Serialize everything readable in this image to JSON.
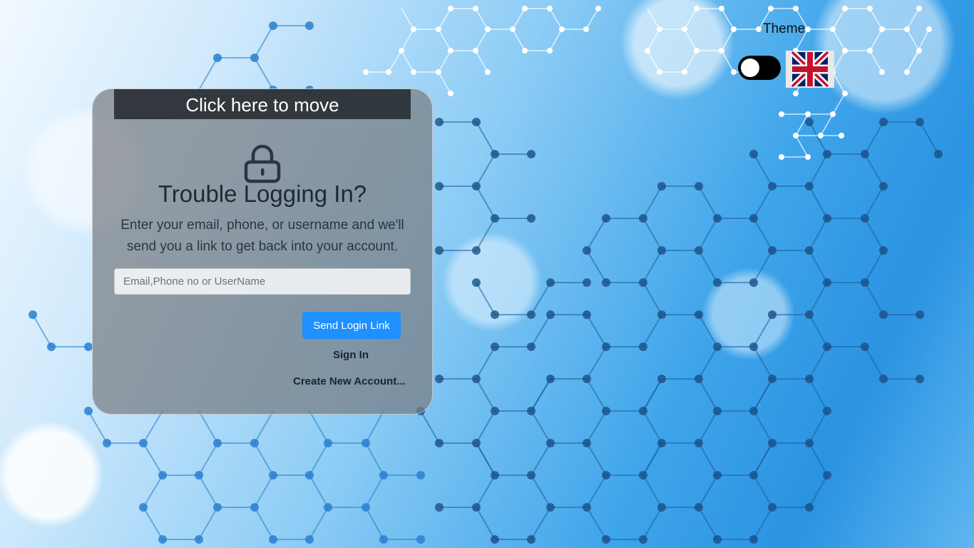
{
  "header": {
    "theme_label": "Theme",
    "theme_toggle_state": "off",
    "language_flag": "uk-flag-icon"
  },
  "card": {
    "move_handle_label": "Click here to move",
    "lock_icon": "lock-icon",
    "title": "Trouble Logging In?",
    "description": "Enter your email, phone, or username and we'll send you a link to get back into your account.",
    "email_input": {
      "placeholder": "Email,Phone no or UserName",
      "value": ""
    },
    "send_button_label": "Send Login Link",
    "sign_in_label": "Sign In",
    "create_account_label": "Create New Account..."
  },
  "colors": {
    "primary_button": "#1e90ff",
    "move_bar": "#2d3236",
    "card_background": "#7d8186"
  }
}
